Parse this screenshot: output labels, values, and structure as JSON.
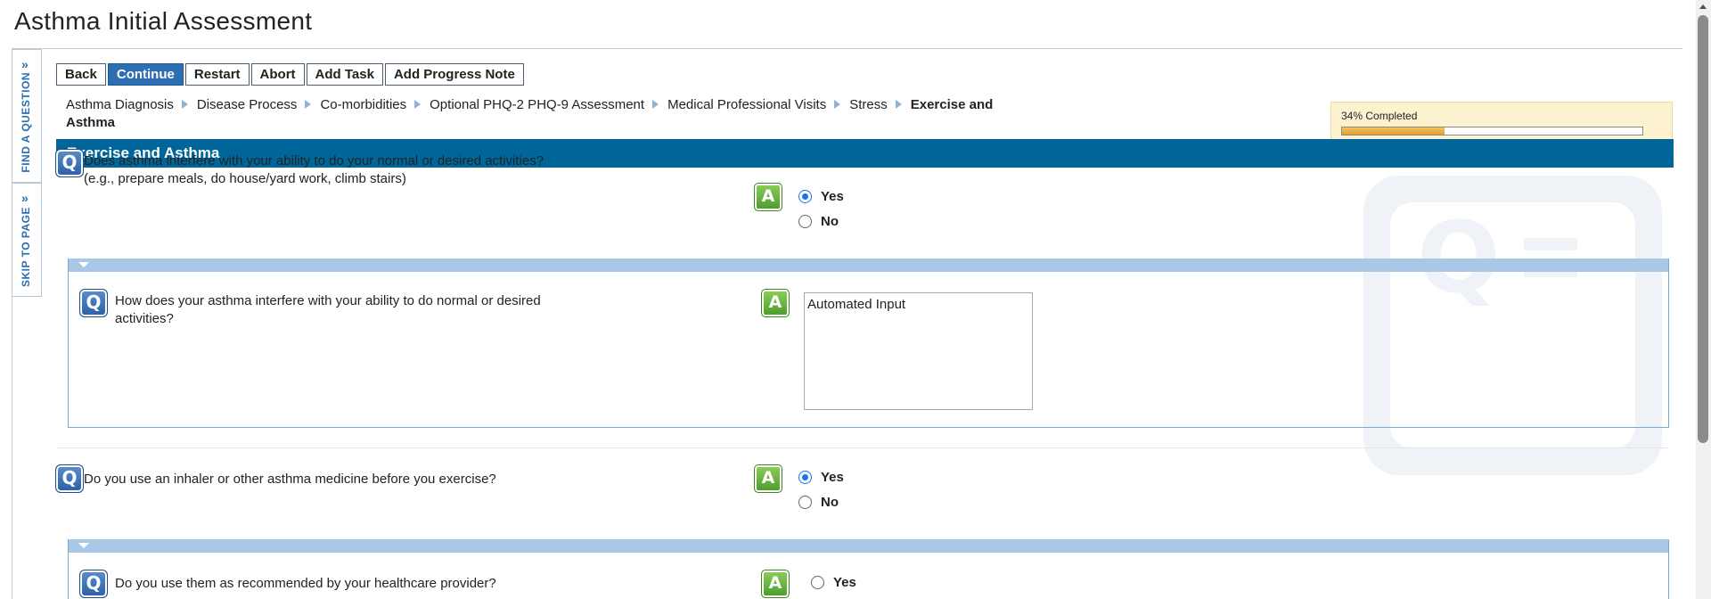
{
  "page": {
    "title": "Asthma Initial Assessment"
  },
  "side_tabs": {
    "find_question": "FIND A QUESTION",
    "skip_to_page": "SKIP TO PAGE",
    "chevron": "»"
  },
  "toolbar": {
    "back": "Back",
    "continue": "Continue",
    "restart": "Restart",
    "abort": "Abort",
    "add_task": "Add Task",
    "add_progress_note": "Add Progress Note"
  },
  "breadcrumb": {
    "items": [
      "Asthma Diagnosis",
      "Disease Process",
      "Co-morbidities",
      "Optional PHQ-2 PHQ-9 Assessment",
      "Medical Professional Visits",
      "Stress"
    ],
    "current": "Exercise and Asthma"
  },
  "progress": {
    "label": "34% Completed",
    "percent": 34
  },
  "section": {
    "title": "Exercise and Asthma"
  },
  "questions": [
    {
      "q_icon": "Q",
      "a_icon": "A",
      "text_line1": "Does asthma interfere with your ability to do your normal or desired activities?",
      "text_line2": "(e.g., prepare meals, do house/yard work, climb stairs)",
      "options": [
        {
          "label": "Yes",
          "selected": true
        },
        {
          "label": "No",
          "selected": false
        }
      ]
    },
    {
      "q_icon": "Q",
      "a_icon": "A",
      "text_line1": "How does your asthma interfere with your ability to do normal or desired",
      "text_line2": "activities?",
      "answer_text": "Automated Input"
    },
    {
      "q_icon": "Q",
      "a_icon": "A",
      "text": "Do you use an inhaler or other asthma medicine before you exercise?",
      "options": [
        {
          "label": "Yes",
          "selected": true
        },
        {
          "label": "No",
          "selected": false
        }
      ]
    },
    {
      "q_icon": "Q",
      "a_icon": "A",
      "text": "Do you use them as recommended by your healthcare provider?",
      "options": [
        {
          "label": "Yes",
          "selected": false
        }
      ]
    }
  ],
  "colors": {
    "section_header": "#006699",
    "primary_button": "#2d6db4",
    "progress_bg": "#fdf2cf",
    "progress_fill": "#e6a02a",
    "subpanel_bar": "#a9c8e8"
  }
}
